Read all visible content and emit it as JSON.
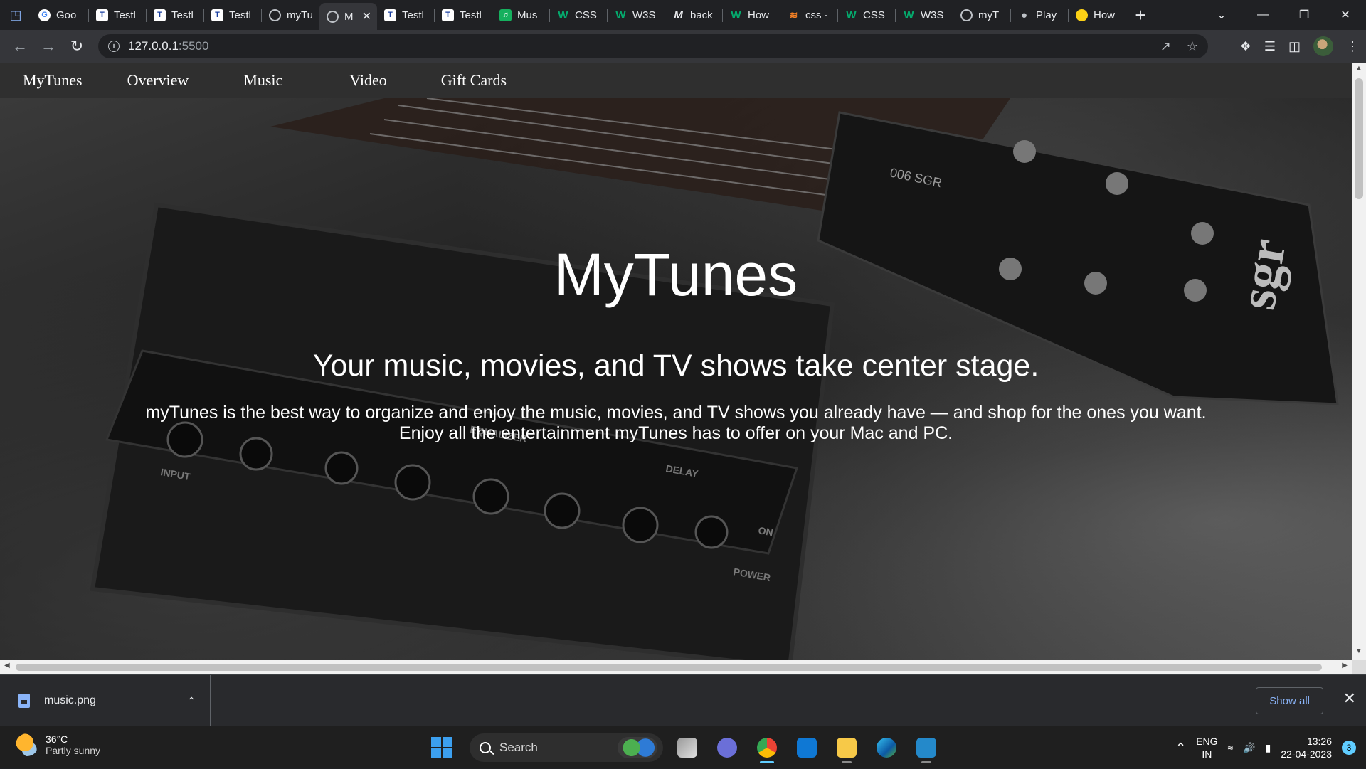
{
  "browser": {
    "tabs": [
      {
        "label": "Goo",
        "favicon": "google-icon",
        "active": false
      },
      {
        "label": "Testl",
        "favicon": "testbook-icon",
        "active": false
      },
      {
        "label": "Testl",
        "favicon": "testbook-icon",
        "active": false
      },
      {
        "label": "Testl",
        "favicon": "testbook-icon",
        "active": false
      },
      {
        "label": "myTu",
        "favicon": "globe-icon",
        "active": false
      },
      {
        "label": "M",
        "favicon": "globe-icon",
        "active": true
      },
      {
        "label": "Testl",
        "favicon": "testbook-icon",
        "active": false
      },
      {
        "label": "Testl",
        "favicon": "testbook-icon",
        "active": false
      },
      {
        "label": "Mus",
        "favicon": "music-app-icon",
        "active": false
      },
      {
        "label": "CSS",
        "favicon": "w3schools-icon",
        "active": false
      },
      {
        "label": "W3S",
        "favicon": "w3schools-icon",
        "active": false
      },
      {
        "label": "back",
        "favicon": "m-icon",
        "active": false
      },
      {
        "label": "How",
        "favicon": "w3schools-icon",
        "active": false
      },
      {
        "label": "css -",
        "favicon": "stackoverflow-icon",
        "active": false
      },
      {
        "label": "CSS",
        "favicon": "w3schools-icon",
        "active": false
      },
      {
        "label": "W3S",
        "favicon": "w3schools-icon",
        "active": false
      },
      {
        "label": "myT",
        "favicon": "globe-icon",
        "active": false
      },
      {
        "label": "Play",
        "favicon": "apple-icon",
        "active": false
      },
      {
        "label": "How",
        "favicon": "yellow-circle-icon",
        "active": false
      }
    ],
    "address": {
      "host": "127.0.0.1",
      "port": ":5500"
    }
  },
  "site": {
    "nav": [
      "MyTunes",
      "Overview",
      "Music",
      "Video",
      "Gift Cards"
    ],
    "hero": {
      "title": "MyTunes",
      "subtitle": "Your music, movies, and TV shows take center stage.",
      "desc_line1": "myTunes is the best way to organize and enjoy the music, movies, and TV shows you already have — and shop for the ones you want.",
      "desc_line2": "Enjoy all the entertainment myTunes has to offer on your Mac and PC."
    },
    "background_art": {
      "string_label": "006 SGR",
      "logo_text": "sgr",
      "amp_labels": [
        "INPUT",
        "EQUALIZER",
        "DELAY",
        "ON",
        "POWER"
      ]
    }
  },
  "downloads": {
    "file": "music.png",
    "show_all": "Show all"
  },
  "taskbar": {
    "weather_temp": "36°C",
    "weather_desc": "Partly sunny",
    "search": "Search",
    "lang_top": "ENG",
    "lang_bottom": "IN",
    "time": "13:26",
    "date": "22-04-2023",
    "notifications": "3"
  },
  "colors": {
    "accent": "#8ab4f8",
    "chrome_dark": "#202124",
    "toolbar": "#35363a",
    "site_nav": "#2f2f2f"
  }
}
